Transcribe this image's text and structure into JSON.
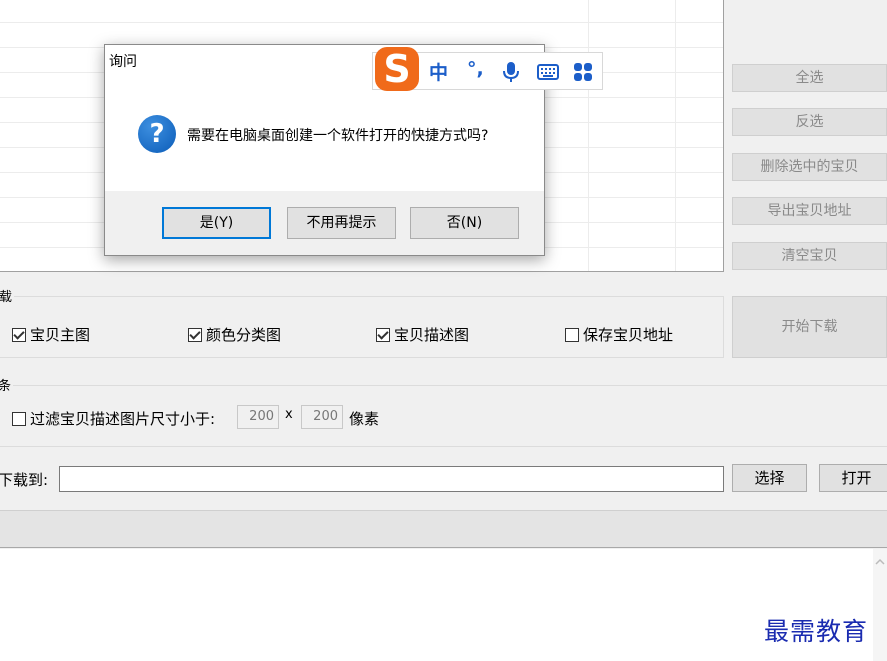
{
  "dialog": {
    "title": "询问",
    "message": "需要在电脑桌面创建一个软件打开的快捷方式吗?",
    "buttons": {
      "yes": "是(Y)",
      "dont_remind": "不用再提示",
      "no": "否(N)"
    },
    "icon": "question-icon"
  },
  "ime_toolbar": {
    "logo": "S",
    "mode": "中",
    "punct": "°,",
    "icons": [
      "microphone-icon",
      "keyboard-icon",
      "grid-apps-icon"
    ]
  },
  "side_buttons": {
    "select_all": "全选",
    "invert": "反选",
    "delete_selected": "删除选中的宝贝",
    "export_address": "导出宝贝地址",
    "clear": "清空宝贝",
    "start_download": "开始下载"
  },
  "download_group": {
    "label": "载",
    "options": [
      {
        "label": "宝贝主图",
        "checked": true
      },
      {
        "label": "颜色分类图",
        "checked": true
      },
      {
        "label": "宝贝描述图",
        "checked": true
      },
      {
        "label": "保存宝贝地址",
        "checked": false
      }
    ]
  },
  "filter_group": {
    "label": "条",
    "filter_label": "过滤宝贝描述图片尺寸小于:",
    "filter_checked": false,
    "width": "200",
    "times": "x",
    "height": "200",
    "unit": "像素"
  },
  "path_row": {
    "label": "下载到:",
    "value": "",
    "choose": "选择",
    "open": "打开"
  },
  "watermark": "最需教育"
}
